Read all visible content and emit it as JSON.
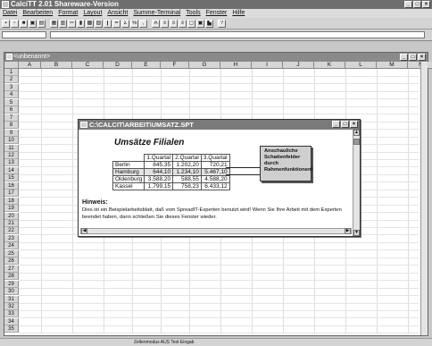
{
  "app": {
    "title": "CalciTT 2.01 Shareware-Version",
    "window_buttons": [
      "_",
      "□",
      "×"
    ]
  },
  "menu": [
    "Datei",
    "Bearbeiten",
    "Format",
    "Layout",
    "Ansicht",
    "Summe-Terminal",
    "Tools",
    "Fenster",
    "Hilfe"
  ],
  "sheet": {
    "title": "<unbenannt>",
    "columns": [
      "A",
      "B",
      "C",
      "D",
      "E",
      "F",
      "G",
      "H",
      "I",
      "J",
      "K",
      "L",
      "M",
      "N"
    ],
    "rows": [
      "1",
      "2",
      "3",
      "4",
      "5",
      "6",
      "7",
      "8",
      "9",
      "10",
      "11",
      "12",
      "13",
      "14",
      "15",
      "16",
      "17",
      "18",
      "19",
      "20",
      "21",
      "22",
      "23",
      "24",
      "25",
      "26",
      "27",
      "28",
      "29",
      "30",
      "31",
      "32",
      "33",
      "34",
      "35"
    ]
  },
  "inner_window": {
    "title": "C:\\CALCIT\\ARBEIT\\UMSATZ.SPT",
    "heading": "Umsätze Filialen",
    "table": {
      "headers": [
        "",
        "1.Quartal",
        "2.Quartal",
        "3.Quartal"
      ],
      "rows": [
        [
          "Berlin",
          "845,35",
          "1.202,20",
          "720,21"
        ],
        [
          "Hamburg",
          "644,10",
          "1.234,10",
          "5.467,10"
        ],
        [
          "Oldenburg",
          "3.588,20",
          "588,55",
          "4.588,20"
        ],
        [
          "Kassel",
          "1.799,15",
          "758,23",
          "6.433,12"
        ]
      ]
    },
    "callout_lines": [
      "Anschauliche",
      "Schattenfelder",
      "durch",
      "Rahmenfunktionen!"
    ],
    "note_title": "Hinweis:",
    "note_text": "Dies ist ein Beispielarbeitsblatt, daß vom SpreadIT-Experten benutzt wird! Wenn Sie Ihre Arbeit mit dem Experten beendet haben, dann schließen Sie dieses Fenster wieder."
  },
  "status": "Zellenmodus  AUS  Text Eingab"
}
